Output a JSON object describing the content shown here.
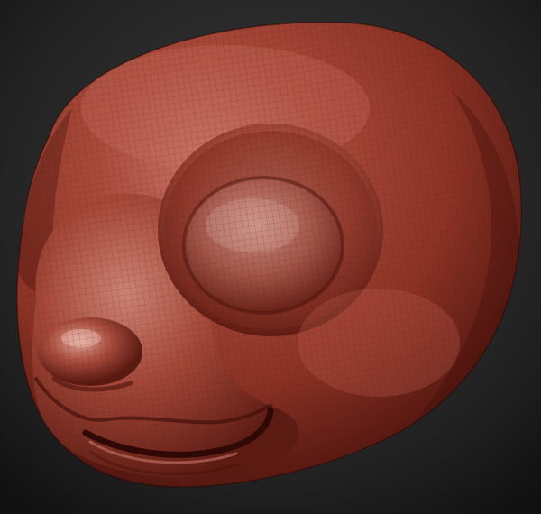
{
  "viewport": {
    "background_center": "#3c3c3c",
    "background_edge": "#111111"
  },
  "model": {
    "subject": "sculpted-head",
    "material_base": "#9a3b2c",
    "material_highlight": "#d79080",
    "material_shadow": "#4a120c",
    "wireframe_visible": true,
    "wireframe_color": "#5a1a12"
  }
}
